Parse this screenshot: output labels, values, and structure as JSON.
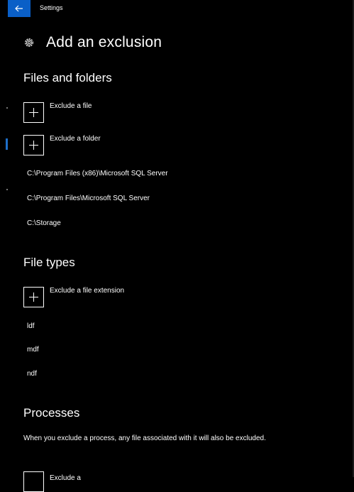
{
  "window": {
    "title": "Settings"
  },
  "header": {
    "title": "Add an exclusion"
  },
  "files_and_folders": {
    "title": "Files and folders",
    "add_file_label": "Exclude a file",
    "add_folder_label": "Exclude a folder",
    "items": [
      "C:\\Program Files (x86)\\Microsoft SQL Server",
      "C:\\Program Files\\Microsoft SQL Server",
      "C:\\Storage"
    ]
  },
  "file_types": {
    "title": "File types",
    "add_label": "Exclude a file extension",
    "items": [
      "ldf",
      "mdf",
      "ndf"
    ]
  },
  "processes": {
    "title": "Processes",
    "description": "When you exclude a process, any file associated with it will also be excluded.",
    "add_label_partial": "Exclude a"
  },
  "colors": {
    "accent": "#0a5fc7",
    "background": "#000000",
    "text": "#ffffff"
  }
}
